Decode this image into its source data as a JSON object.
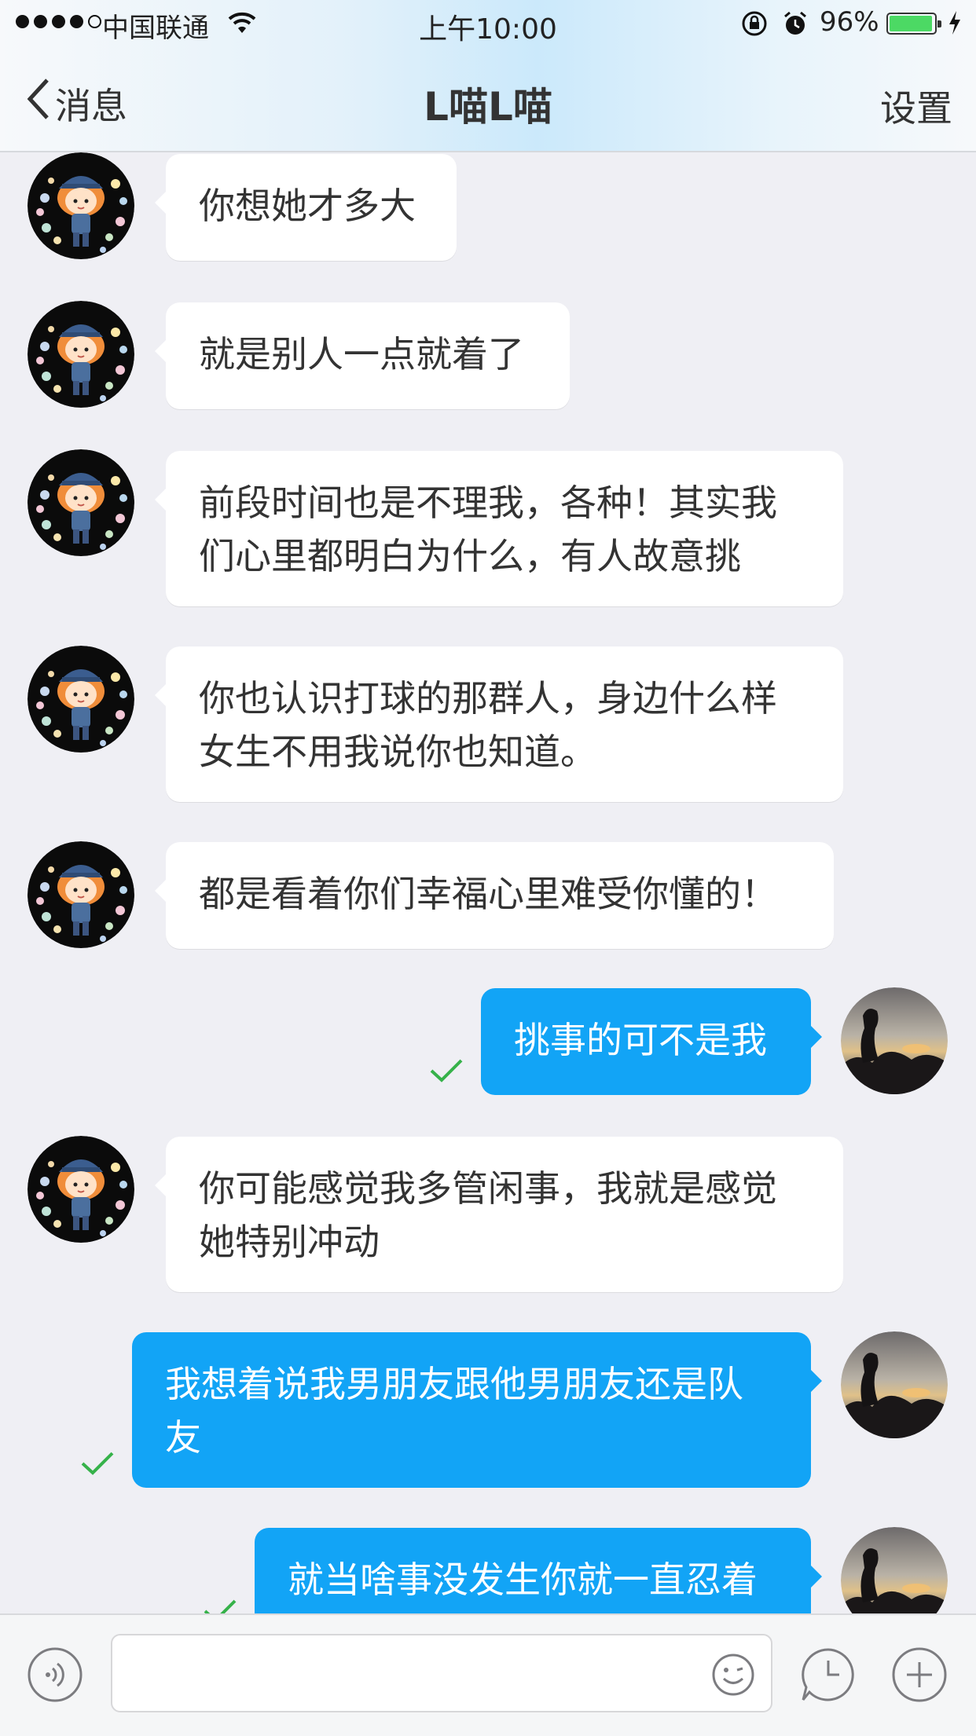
{
  "status_bar": {
    "carrier": "中国联通",
    "time": "上午10:00",
    "battery_percent": "96%",
    "battery_level": 0.96
  },
  "nav": {
    "back_label": "消息",
    "title": "L喵L喵",
    "settings_label": "设置"
  },
  "messages": [
    {
      "side": "in",
      "text": "你想她才多大"
    },
    {
      "side": "in",
      "text": "就是别人一点就着了"
    },
    {
      "side": "in",
      "text": "前段时间也是不理我，各种！其实我们心里都明白为什么，有人故意挑"
    },
    {
      "side": "in",
      "text": "你也认识打球的那群人，身边什么样女生不用我说你也知道。"
    },
    {
      "side": "in",
      "text": "都是看着你们幸福心里难受你懂的！"
    },
    {
      "side": "out",
      "text": "挑事的可不是我",
      "read": true
    },
    {
      "side": "in",
      "text": "你可能感觉我多管闲事，我就是感觉她特别冲动"
    },
    {
      "side": "out",
      "text": "我想着说我男朋友跟他男朋友还是队友",
      "read": true
    },
    {
      "side": "out",
      "text": "就当啥事没发生你就一直忍着",
      "read": true
    }
  ],
  "input": {
    "placeholder": "",
    "icons": [
      "voice-icon",
      "emoji-icon",
      "clock-icon",
      "plus-icon"
    ]
  },
  "colors": {
    "outgoing_bubble": "#12a4f6",
    "incoming_bubble": "#ffffff",
    "read_check": "#36b24a"
  }
}
